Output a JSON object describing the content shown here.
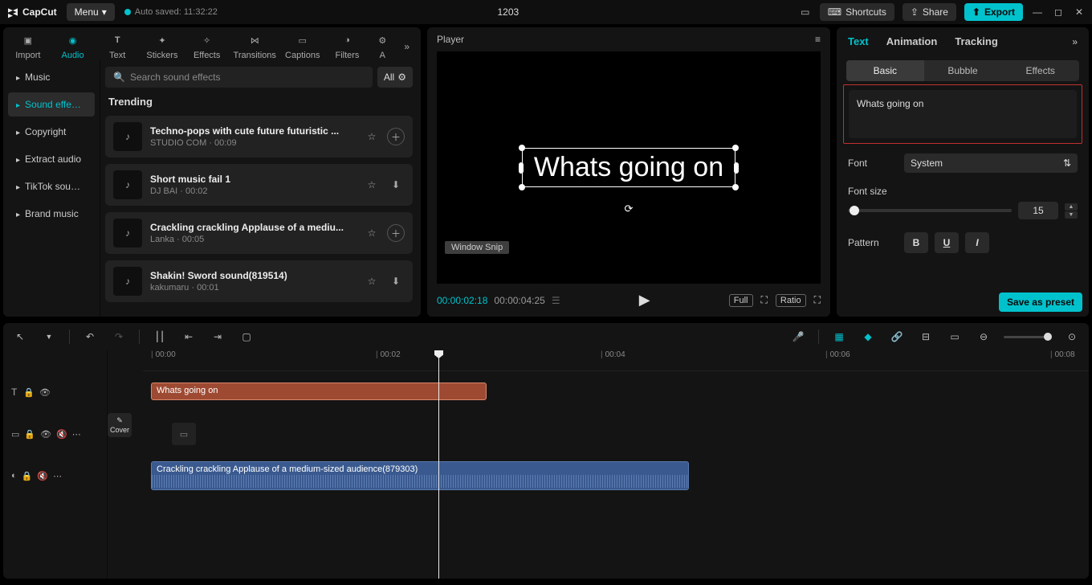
{
  "app": {
    "name": "CapCut",
    "menu_label": "Menu",
    "autosave": "Auto saved: 11:32:22",
    "project_title": "1203"
  },
  "titlebar": {
    "shortcuts": "Shortcuts",
    "share": "Share",
    "export": "Export"
  },
  "toptabs": [
    "Import",
    "Audio",
    "Text",
    "Stickers",
    "Effects",
    "Transitions",
    "Captions",
    "Filters",
    "A"
  ],
  "toptab_active": 1,
  "subnav": {
    "items": [
      "Music",
      "Sound effe…",
      "Copyright",
      "Extract audio",
      "TikTok sou…",
      "Brand music"
    ],
    "active": 1
  },
  "search": {
    "placeholder": "Search sound effects",
    "all_label": "All"
  },
  "list": {
    "section": "Trending",
    "items": [
      {
        "title": "Techno-pops with cute future futuristic ...",
        "sub": "STUDIO COM · 00:09",
        "action": "add"
      },
      {
        "title": "Short music fail 1",
        "sub": "DJ BAI · 00:02",
        "action": "download"
      },
      {
        "title": "Crackling crackling Applause of a mediu...",
        "sub": "Lanka · 00:05",
        "action": "add"
      },
      {
        "title": "Shakin! Sword sound(819514)",
        "sub": "kakumaru · 00:01",
        "action": "download"
      }
    ]
  },
  "player": {
    "header": "Player",
    "overlay_text": "Whats going on",
    "snip_label": "Window Snip",
    "tc_current": "00:00:02:18",
    "tc_total": "00:00:04:25",
    "full": "Full",
    "ratio": "Ratio"
  },
  "right": {
    "tabs": [
      "Text",
      "Animation",
      "Tracking"
    ],
    "tab_active": 0,
    "subtabs": [
      "Basic",
      "Bubble",
      "Effects"
    ],
    "subtab_active": 0,
    "text_value": "Whats going on",
    "font_label": "Font",
    "font_value": "System",
    "fontsize_label": "Font size",
    "fontsize_value": "15",
    "pattern_label": "Pattern",
    "save_preset": "Save as preset"
  },
  "ruler": [
    "00:00",
    "00:02",
    "00:04",
    "00:06",
    "00:08"
  ],
  "timeline": {
    "text_clip": "Whats going on",
    "audio_clip": "Crackling crackling Applause of a medium-sized audience(879303)",
    "cover_label": "Cover"
  }
}
